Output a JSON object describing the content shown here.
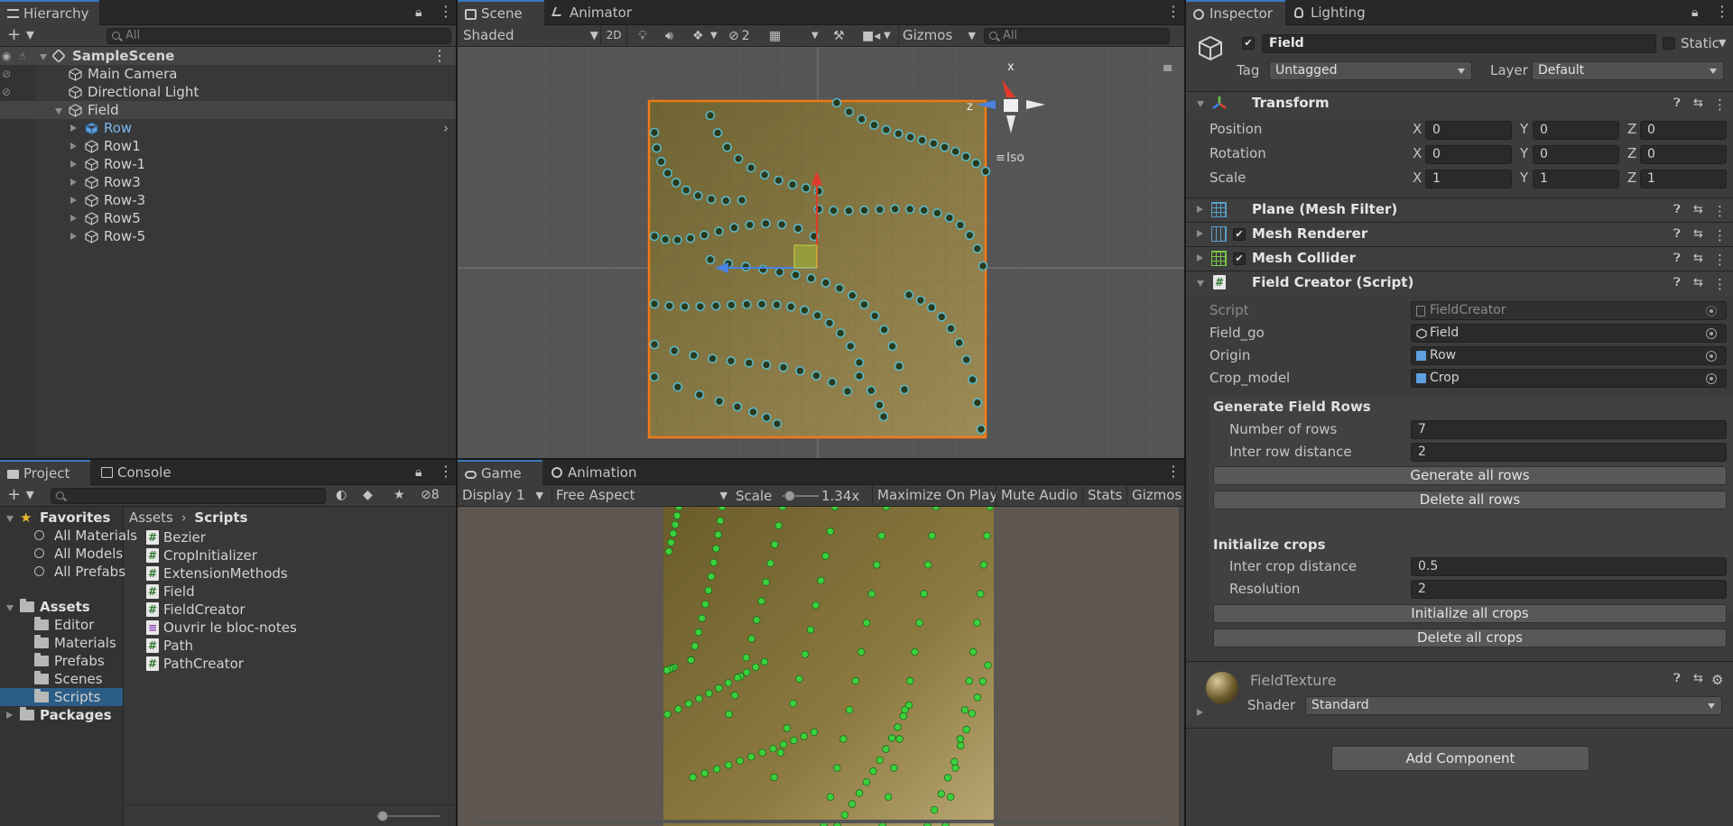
{
  "hierarchy": {
    "tab": "Hierarchy",
    "search_placeholder": "All",
    "add_label": "+",
    "scene": "SampleScene",
    "items": [
      {
        "label": "Main Camera",
        "depth": 1
      },
      {
        "label": "Directional Light",
        "depth": 1
      },
      {
        "label": "Field",
        "depth": 1
      },
      {
        "label": "Row",
        "depth": 2
      },
      {
        "label": "Row1",
        "depth": 2
      },
      {
        "label": "Row-1",
        "depth": 2
      },
      {
        "label": "Row3",
        "depth": 2
      },
      {
        "label": "Row-3",
        "depth": 2
      },
      {
        "label": "Row5",
        "depth": 2
      },
      {
        "label": "Row-5",
        "depth": 2
      }
    ]
  },
  "scene": {
    "tabs": [
      "Scene",
      "Animator"
    ],
    "shading": "Shaded",
    "mode_2d": "2D",
    "hidden_count": "2",
    "gizmos": "Gizmos",
    "search_placeholder": "All",
    "projection": "Iso",
    "axis_x": "x",
    "axis_z": "z"
  },
  "game": {
    "tabs": [
      "Game",
      "Animation"
    ],
    "display": "Display 1",
    "aspect": "Free Aspect",
    "scale_label": "Scale",
    "scale_value": "1.34x",
    "scale_fraction": 0.2,
    "maximize": "Maximize On Play",
    "mute": "Mute Audio",
    "stats": "Stats",
    "gizmos": "Gizmos"
  },
  "project": {
    "tabs": [
      "Project",
      "Console"
    ],
    "hidden_count": "8",
    "zoom_fraction": 0.1,
    "tree": [
      {
        "label": "Favorites",
        "kind": "fav",
        "depth": 0
      },
      {
        "label": "All Materials",
        "kind": "search",
        "depth": 1
      },
      {
        "label": "All Models",
        "kind": "search",
        "depth": 1
      },
      {
        "label": "All Prefabs",
        "kind": "search",
        "depth": 1
      },
      {
        "label": "Assets",
        "kind": "folder-open",
        "depth": 0
      },
      {
        "label": "Editor",
        "kind": "folder",
        "depth": 1
      },
      {
        "label": "Materials",
        "kind": "folder",
        "depth": 1
      },
      {
        "label": "Prefabs",
        "kind": "folder",
        "depth": 1
      },
      {
        "label": "Scenes",
        "kind": "folder",
        "depth": 1
      },
      {
        "label": "Scripts",
        "kind": "folder",
        "depth": 1,
        "selected": true
      },
      {
        "label": "Packages",
        "kind": "folder",
        "depth": 0
      }
    ],
    "breadcrumb": [
      "Assets",
      "Scripts"
    ],
    "files": [
      {
        "label": "Bezier",
        "kind": "cs"
      },
      {
        "label": "CropInitializer",
        "kind": "cs"
      },
      {
        "label": "ExtensionMethods",
        "kind": "cs"
      },
      {
        "label": "Field",
        "kind": "cs"
      },
      {
        "label": "FieldCreator",
        "kind": "cs"
      },
      {
        "label": "Ouvrir le bloc-notes",
        "kind": "txt"
      },
      {
        "label": "Path",
        "kind": "cs"
      },
      {
        "label": "PathCreator",
        "kind": "cs"
      }
    ]
  },
  "inspector": {
    "tabs": [
      "Inspector",
      "Lighting"
    ],
    "object_name": "Field",
    "static_label": "Static",
    "tag_label": "Tag",
    "tag_value": "Untagged",
    "layer_label": "Layer",
    "layer_value": "Default",
    "transform": {
      "title": "Transform",
      "position": {
        "label": "Position",
        "x": "0",
        "y": "0",
        "z": "0"
      },
      "rotation": {
        "label": "Rotation",
        "x": "0",
        "y": "0",
        "z": "0"
      },
      "scale": {
        "label": "Scale",
        "x": "1",
        "y": "1",
        "z": "1"
      },
      "axis_labels": [
        "X",
        "Y",
        "Z"
      ]
    },
    "mesh_filter": "Plane (Mesh Filter)",
    "mesh_renderer": "Mesh Renderer",
    "mesh_collider": "Mesh Collider",
    "field_creator": {
      "title": "Field Creator (Script)",
      "script_label": "Script",
      "script_value": "FieldCreator",
      "field_go_label": "Field_go",
      "field_go_value": "Field",
      "origin_label": "Origin",
      "origin_value": "Row",
      "crop_model_label": "Crop_model",
      "crop_model_value": "Crop",
      "generate_header": "Generate Field Rows",
      "num_rows_label": "Number of rows",
      "num_rows_value": "7",
      "inter_row_label": "Inter row distance",
      "inter_row_value": "2",
      "generate_btn": "Generate all rows",
      "delete_rows_btn": "Delete all rows",
      "init_header": "Initialize crops",
      "inter_crop_label": "Inter crop distance",
      "inter_crop_value": "0.5",
      "resolution_label": "Resolution",
      "resolution_value": "2",
      "init_btn": "Initialize all crops",
      "delete_crops_btn": "Delete all crops"
    },
    "material": {
      "name": "FieldTexture",
      "shader_label": "Shader",
      "shader_value": "Standard"
    },
    "add_component": "Add Component"
  },
  "colors": {
    "accent": "#3a79bb",
    "selection": "#2c5d87",
    "ground": "#8a7a3a",
    "crop": "#3cd13c",
    "outline": "#f27b18"
  }
}
